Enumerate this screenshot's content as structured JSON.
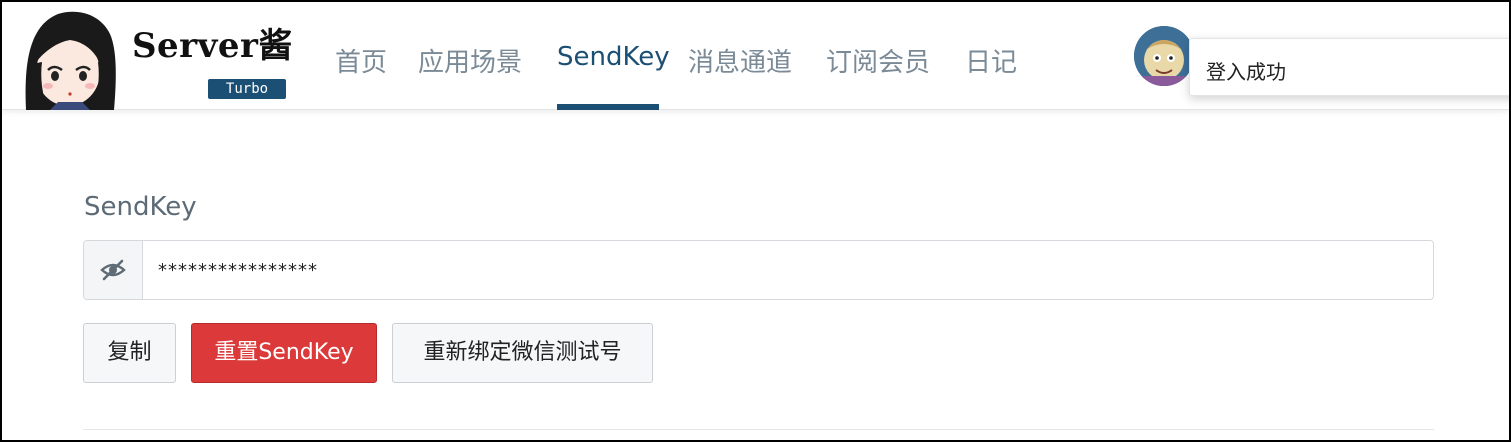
{
  "brand": {
    "name": "Server酱",
    "badge": "Turbo"
  },
  "nav": {
    "items": [
      {
        "label": "首页"
      },
      {
        "label": "应用场景"
      },
      {
        "label": "SendKey"
      },
      {
        "label": "消息通道"
      },
      {
        "label": "订阅会员"
      },
      {
        "label": "日记"
      }
    ],
    "active": "SendKey"
  },
  "toast": {
    "message": "登入成功"
  },
  "sendkey": {
    "label": "SendKey",
    "value": "****************",
    "toggle_icon": "eye-slash-icon"
  },
  "actions": {
    "copy_label": "复制",
    "reset_label": "重置SendKey",
    "rebind_label": "重新绑定微信测试号"
  },
  "colors": {
    "brand": "#1c4f74",
    "danger": "#dc3a3a",
    "nav_text": "#7a8a97"
  }
}
